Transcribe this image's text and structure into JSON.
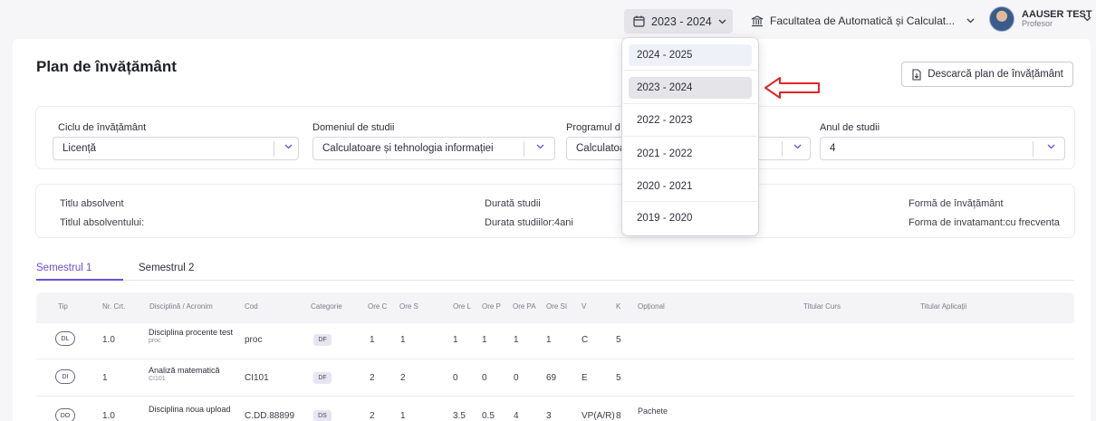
{
  "topbar": {
    "year_selected": "2023 - 2024",
    "faculty": "Facultatea de Automatică și Calculat...",
    "user_name": "AAUSER TEST",
    "user_role": "Profesor"
  },
  "page": {
    "title": "Plan de învățământ",
    "download_label": "Descarcă plan de învățământ"
  },
  "filters": {
    "ciclu_label": "Ciclu de învățământ",
    "ciclu_value": "Licență",
    "domeniu_label": "Domeniul de studii",
    "domeniu_value": "Calculatoare și tehnologia informației",
    "program_label": "Programul d",
    "program_value": "Calculatoa",
    "an_label": "Anul de studii",
    "an_value": "4"
  },
  "info": {
    "titlu_label": "Titlu absolvent",
    "titlu_value": "Titlul absolventului:",
    "durata_label": "Durată studii",
    "durata_value": "Durata studiilor:4ani",
    "forma_label": "Formă de învățământ",
    "forma_value": "Forma de invatamant:cu frecventa"
  },
  "tabs": [
    "Semestrul 1",
    "Semestrul 2"
  ],
  "table": {
    "headers": [
      "Tip",
      "Nr. Crt.",
      "Disciplină / Acronim",
      "Cod",
      "Categorie",
      "Ore C",
      "Ore S",
      "Ore L",
      "Ore P",
      "Ore PA",
      "Ore SI",
      "V",
      "K",
      "Opțional",
      "Titular Curs",
      "Titular Aplicații"
    ],
    "rows": [
      {
        "tip": "DL",
        "nr": "1.0",
        "disc": "Disciplina procente test",
        "acronim": "proc",
        "cod": "proc",
        "cat": "DF",
        "c": "1",
        "s": "1",
        "l": "1",
        "p": "1",
        "pa": "1",
        "si": "1",
        "v": "C",
        "k": "5",
        "opt": ""
      },
      {
        "tip": "DI",
        "nr": "1",
        "disc": "Analiză matematică",
        "acronim": "CI101",
        "cod": "CI101",
        "cat": "DF",
        "c": "2",
        "s": "2",
        "l": "0",
        "p": "0",
        "pa": "0",
        "si": "69",
        "v": "E",
        "k": "5",
        "opt": ""
      },
      {
        "tip": "DO",
        "nr": "1.0",
        "disc": "Disciplina noua upload",
        "acronim": "",
        "cod": "C.DD.88899",
        "cat": "DS",
        "c": "2",
        "s": "1",
        "l": "3.5",
        "p": "0.5",
        "pa": "4",
        "si": "3",
        "v": "VP(A/R)",
        "k": "8",
        "opt": "Pachete"
      }
    ]
  },
  "dropdown": {
    "options": [
      "2024 - 2025",
      "2023 - 2024",
      "2022 - 2023",
      "2021 - 2022",
      "2020 - 2021",
      "2019 - 2020"
    ],
    "selected": "2023 - 2024"
  },
  "colors": {
    "accent": "#6b4fd8",
    "annotation_arrow": "#e0262b"
  }
}
